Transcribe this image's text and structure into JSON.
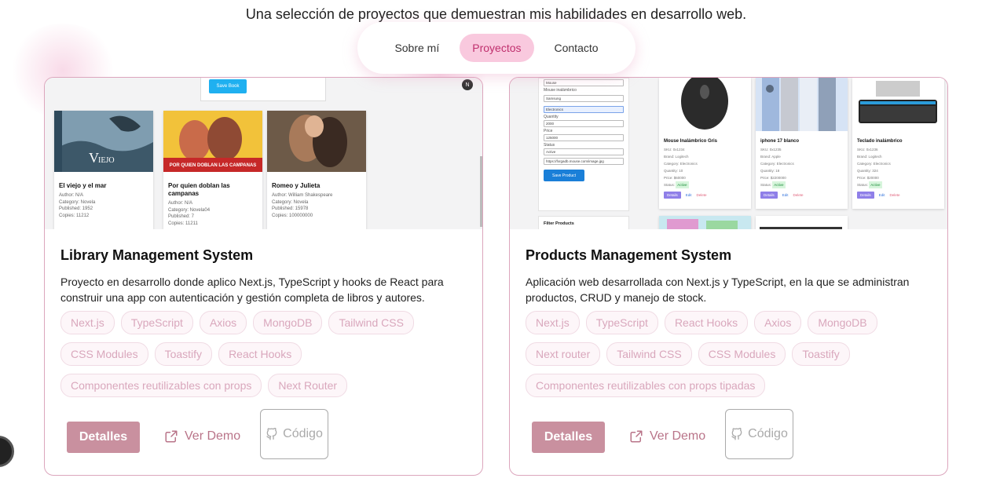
{
  "header": {
    "subtitle": "Una selección de proyectos que demuestran mis habilidades en desarrollo web."
  },
  "nav": {
    "items": [
      {
        "label": "Sobre mí",
        "active": false
      },
      {
        "label": "Proyectos",
        "active": true
      },
      {
        "label": "Contacto",
        "active": false
      }
    ]
  },
  "colors": {
    "accent": "#c9909f",
    "nav_active_bg": "#f9c9de",
    "tag_text": "#d9a7bc",
    "card_border": "#dca6bd"
  },
  "projects": [
    {
      "title": "Library Management System",
      "description": "Proyecto en desarrollo donde aplico Next.js, TypeScript y hooks de React para construir una app con autenticación y gestión completa de libros y autores.",
      "tags": [
        "Next.js",
        "TypeScript",
        "Axios",
        "MongoDB",
        "Tailwind CSS",
        "CSS Modules",
        "Toastify",
        "React Hooks",
        "Componentes reutilizables con props",
        "Next Router"
      ],
      "details_label": "Detalles",
      "demo_label": "Ver Demo",
      "code_label": "Código",
      "screenshot": {
        "save_button": "Save Book",
        "badge": "N",
        "books": [
          {
            "title": "El viejo y el mar",
            "cover_text": "EL VIEJO",
            "meta": [
              "Author: N/A",
              "Category: Novela",
              "Published: 1952",
              "Copies: 11212"
            ]
          },
          {
            "title": "Por quien doblan las campanas",
            "cover_text": "POR QUIEN DOBLAN LAS CAMPANAS",
            "meta": [
              "Author: N/A",
              "Category: Novela04",
              "Published: 7",
              "Copies: 11211"
            ]
          },
          {
            "title": "Romeo y Julieta",
            "cover_text": "",
            "meta": [
              "Author: William Shakespeare",
              "Category: Novela",
              "Published: 15978",
              "Copies: 100000000"
            ]
          }
        ]
      }
    },
    {
      "title": "Products Management System",
      "description": "Aplicación web desarrollada con Next.js y TypeScript, en la que se administran productos, CRUD y manejo de stock.",
      "tags": [
        "Next.js",
        "TypeScript",
        "React Hooks",
        "Axios",
        "MongoDB",
        "Next router",
        "Tailwind CSS",
        "CSS Modules",
        "Toastify",
        "Componentes reutilizables con props tipadas"
      ],
      "details_label": "Detalles",
      "demo_label": "Ver Demo",
      "code_label": "Código",
      "screenshot": {
        "form_fields": [
          {
            "label": "",
            "value": "Mouse",
            "highlight": false
          },
          {
            "label": "Mouse inalámbrico",
            "value": "",
            "highlight": false
          },
          {
            "label": "",
            "value": "Samsung",
            "highlight": false
          },
          {
            "label": "",
            "value": "Electronics",
            "highlight": true
          },
          {
            "label": "Quantity",
            "value": "2000",
            "highlight": false
          },
          {
            "label": "Price",
            "value": "125000",
            "highlight": false
          },
          {
            "label": "Status",
            "value": "Active",
            "highlight": false
          },
          {
            "label": "",
            "value": "https://fxrgadb.mouse.com/image.jpg",
            "highlight": false
          }
        ],
        "save_button": "Save Product",
        "filter_title": "Filter Products",
        "products": [
          {
            "name": "Mouse Inalámbrico Gris",
            "meta": [
              "SKU: 0x1234",
              "Brand: Logitech",
              "Category: Electronics",
              "Quantity: 10",
              "Price: $60000"
            ],
            "status": "Active"
          },
          {
            "name": "iphone 17 blanco",
            "meta": [
              "SKU: 0x1235",
              "Brand: Apple",
              "Category: Electronics",
              "Quantity: 18",
              "Price: $2200000"
            ],
            "status": "Active"
          },
          {
            "name": "Teclado inalámbrico",
            "meta": [
              "SKU: 0x1236",
              "Brand: Logitech",
              "Category: Electronics",
              "Quantity: 324",
              "Price: $20000"
            ],
            "status": "Active"
          }
        ],
        "action_labels": {
          "details": "Details",
          "edit": "Edit",
          "delete": "Delete"
        }
      }
    }
  ]
}
